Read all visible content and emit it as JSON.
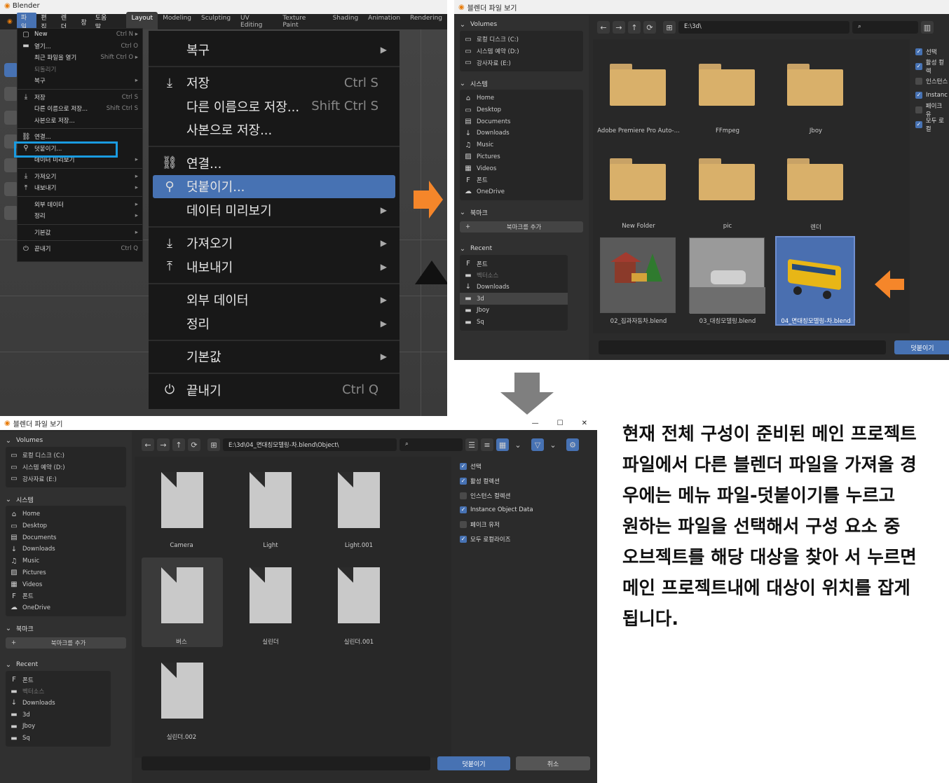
{
  "p1": {
    "title": "Blender",
    "menubar": [
      "파일",
      "편집",
      "렌더",
      "창",
      "도움말"
    ],
    "workspaces": [
      "Layout",
      "Modeling",
      "Sculpting",
      "UV Editing",
      "Texture Paint",
      "Shading",
      "Animation",
      "Rendering"
    ],
    "small_menu": [
      {
        "label": "New",
        "shortcut": "Ctrl N ▸",
        "icon": "new-file-icon"
      },
      {
        "label": "열기...",
        "shortcut": "Ctrl O",
        "icon": "folder-icon"
      },
      {
        "label": "최근 파일을 열기",
        "shortcut": "Shift Ctrl O ▸",
        "icon": ""
      },
      {
        "label": "되돌리기",
        "shortcut": "",
        "icon": "",
        "disabled": true
      },
      {
        "label": "복구",
        "shortcut": "▸",
        "icon": ""
      },
      {
        "sep": true
      },
      {
        "label": "저장",
        "shortcut": "Ctrl S",
        "icon": "save-icon"
      },
      {
        "label": "다른 이름으로 저장...",
        "shortcut": "Shift Ctrl S",
        "icon": ""
      },
      {
        "label": "사본으로 저장...",
        "shortcut": "",
        "icon": ""
      },
      {
        "sep": true
      },
      {
        "label": "연결...",
        "shortcut": "",
        "icon": "link-icon"
      },
      {
        "label": "덧붙이기...",
        "shortcut": "",
        "icon": "append-icon"
      },
      {
        "label": "데이터 미리보기",
        "shortcut": "▸",
        "icon": ""
      },
      {
        "sep": true
      },
      {
        "label": "가져오기",
        "shortcut": "▸",
        "icon": "import-icon"
      },
      {
        "label": "내보내기",
        "shortcut": "▸",
        "icon": "export-icon"
      },
      {
        "sep": true
      },
      {
        "label": "외부 데이터",
        "shortcut": "▸",
        "icon": ""
      },
      {
        "label": "정리",
        "shortcut": "▸",
        "icon": ""
      },
      {
        "sep": true
      },
      {
        "label": "기본값",
        "shortcut": "▸",
        "icon": ""
      },
      {
        "sep": true
      },
      {
        "label": "끝내기",
        "shortcut": "Ctrl Q",
        "icon": "power-icon"
      }
    ],
    "big_menu": [
      {
        "label": "복구",
        "shortcut": "",
        "arrow": "▶",
        "icon": ""
      },
      {
        "sep": true
      },
      {
        "label": "저장",
        "shortcut": "Ctrl S",
        "arrow": "",
        "icon": "save-icon"
      },
      {
        "label": "다른 이름으로 저장...",
        "shortcut": "Shift Ctrl S",
        "arrow": "",
        "icon": ""
      },
      {
        "label": "사본으로 저장...",
        "shortcut": "",
        "arrow": "",
        "icon": ""
      },
      {
        "sep": true
      },
      {
        "label": "연결...",
        "shortcut": "",
        "arrow": "",
        "icon": "link-icon"
      },
      {
        "label": "덧붙이기...",
        "shortcut": "",
        "arrow": "",
        "icon": "append-icon",
        "highlight": true
      },
      {
        "label": "데이터 미리보기",
        "shortcut": "",
        "arrow": "▶",
        "icon": ""
      },
      {
        "sep": true
      },
      {
        "label": "가져오기",
        "shortcut": "",
        "arrow": "▶",
        "icon": "import-icon"
      },
      {
        "label": "내보내기",
        "shortcut": "",
        "arrow": "▶",
        "icon": "export-icon"
      },
      {
        "sep": true
      },
      {
        "label": "외부 데이터",
        "shortcut": "",
        "arrow": "▶",
        "icon": ""
      },
      {
        "label": "정리",
        "shortcut": "",
        "arrow": "▶",
        "icon": ""
      },
      {
        "sep": true
      },
      {
        "label": "기본값",
        "shortcut": "",
        "arrow": "▶",
        "icon": ""
      },
      {
        "sep": true
      },
      {
        "label": "끝내기",
        "shortcut": "Ctrl Q",
        "arrow": "",
        "icon": "power-icon"
      }
    ]
  },
  "p2": {
    "title": "블렌더 파일 보기",
    "volumes_label": "Volumes",
    "volumes": [
      "로컬 디스크 (C:)",
      "시스템 예약 (D:)",
      "강사자료 (E:)"
    ],
    "system_label": "시스템",
    "system": [
      "Home",
      "Desktop",
      "Documents",
      "Downloads",
      "Music",
      "Pictures",
      "Videos",
      "폰트",
      "OneDrive"
    ],
    "bookmarks_label": "북마크",
    "add_bookmark": "북마크를 추가",
    "recent_label": "Recent",
    "recent": [
      "폰트",
      "벡터소스",
      "Downloads",
      "3d",
      "Jboy",
      "Sq"
    ],
    "path": "E:\\3d\\",
    "folders": [
      "Adobe Premiere Pro Auto-...",
      "FFmpeg",
      "Jboy",
      "New Folder",
      "pic",
      "렌더"
    ],
    "files": [
      "02_집과자동차.blend",
      "03_대칭모델링.blend",
      "04_면대칭모델링-차.blend"
    ],
    "options": [
      {
        "label": "선택",
        "checked": true
      },
      {
        "label": "활성 컬렉",
        "checked": true
      },
      {
        "label": "인스턴스",
        "checked": false
      },
      {
        "label": "Instanc",
        "checked": true
      },
      {
        "label": "페이크 유",
        "checked": false
      },
      {
        "label": "모두 로컬",
        "checked": true
      }
    ],
    "append_button": "덧붙이기"
  },
  "p3": {
    "title": "블렌더 파일 보기",
    "volumes_label": "Volumes",
    "volumes": [
      "로컬 디스크 (C:)",
      "시스템 예약 (D:)",
      "강사자료 (E:)"
    ],
    "system_label": "시스템",
    "system": [
      "Home",
      "Desktop",
      "Documents",
      "Downloads",
      "Music",
      "Pictures",
      "Videos",
      "폰트",
      "OneDrive"
    ],
    "bookmarks_label": "북마크",
    "add_bookmark": "북마크를 추가",
    "recent_label": "Recent",
    "recent": [
      "폰트",
      "벡터소스",
      "Downloads",
      "3d",
      "Jboy",
      "Sq"
    ],
    "path": "E:\\3d\\04_면대칭모델링-차.blend\\Object\\",
    "objects": [
      "Camera",
      "Light",
      "Light.001",
      "버스",
      "실린더",
      "실린더.001",
      "실린더.002"
    ],
    "options": [
      {
        "label": "선택",
        "checked": true
      },
      {
        "label": "활성 컬렉션",
        "checked": true
      },
      {
        "label": "인스턴스 컬렉션",
        "checked": false
      },
      {
        "label": "Instance Object Data",
        "checked": true
      },
      {
        "label": "페이크 유저",
        "checked": false
      },
      {
        "label": "모두 로컬라이즈",
        "checked": true
      }
    ],
    "append_button": "덧붙이기",
    "cancel_button": "취소",
    "window_controls": [
      "—",
      "☐",
      "✕"
    ]
  },
  "explanation": [
    "현재 전체 구성이 준비된 메인 프로젝트",
    "파일에서 다른 블렌더 파일을 가져올 경",
    "우에는 메뉴 파일-덧붙이기를 누르고",
    "원하는 파일을 선택해서 구성 요소 중",
    "오브젝트를 해당 대상을 찾아 서 누르면",
    "메인 프로젝트내에 대상이 위치를 잡게",
    "됩니다."
  ],
  "colors": {
    "accent": "#4772b3",
    "highlight_box": "#1a9be0",
    "arrow_orange": "#f5862a",
    "arrow_gray": "#7f7f7f",
    "folder": "#d9b06a"
  }
}
